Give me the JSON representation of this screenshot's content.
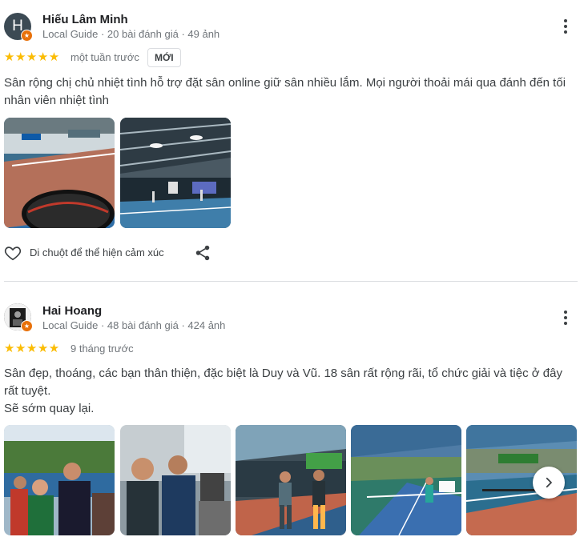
{
  "reviews": [
    {
      "author": "Hiếu Lâm Minh",
      "avatar_letter": "H",
      "meta": "Local Guide · 20 bài đánh giá · 49 ảnh",
      "stars": "★★★★★",
      "rating": 5,
      "time": "một tuần trước",
      "badge": "MỚI",
      "text": "Sân rộng chị chủ nhiệt tình hỗ trợ đặt sân online giữ sân nhiều lắm. Mọi người thoải mái qua đánh đến tối nhân viên nhiệt tình",
      "like_label": "Di chuột để thể hiện cảm xúc"
    },
    {
      "author": "Hai Hoang",
      "meta": "Local Guide · 48 bài đánh giá · 424 ảnh",
      "stars": "★★★★★",
      "rating": 5,
      "time": "9 tháng trước",
      "text_line1": "Sân đẹp, thoáng, các bạn thân thiện, đặc biệt là Duy và Vũ. 18 sân rất rộng rãi, tổ chức giải và tiệc ở đây rất tuyệt.",
      "text_line2": "Sẽ sớm quay lại."
    }
  ],
  "icons": {
    "guide": "star-badge-icon",
    "more": "more-vert-icon",
    "like": "heart-outline-icon",
    "share": "share-icon",
    "next": "chevron-right-icon"
  },
  "colors": {
    "star": "#fbbc04",
    "guide_badge": "#e8710a",
    "avatar_bg": "#3c4a54"
  }
}
